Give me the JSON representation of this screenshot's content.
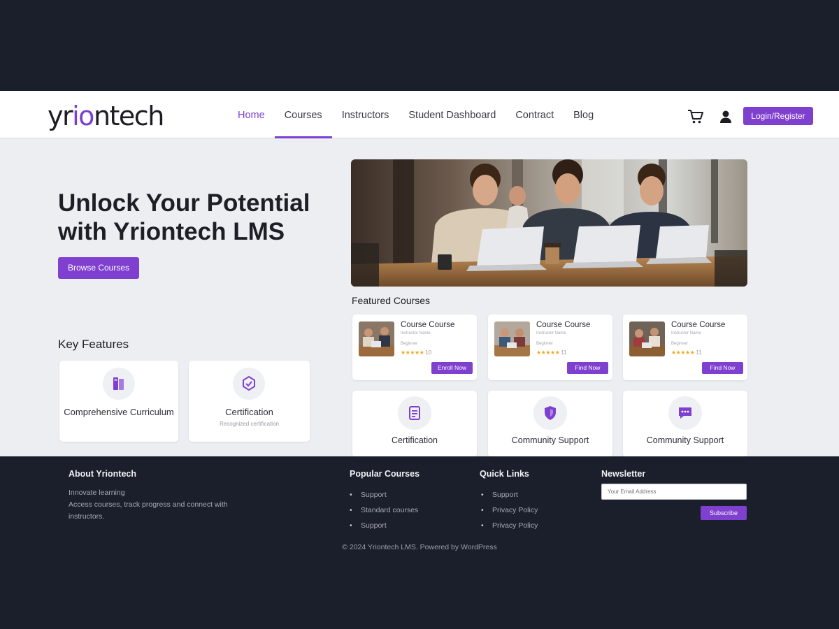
{
  "header": {
    "logo_text_start": "yr",
    "logo_text_dot": "io",
    "logo_text_end": "ntech",
    "nav": [
      {
        "label": "Home"
      },
      {
        "label": "Courses"
      },
      {
        "label": "Instructors"
      },
      {
        "label": "Student Dashboard"
      },
      {
        "label": "Contract"
      },
      {
        "label": "Blog"
      }
    ],
    "login_label": "Login/Register",
    "icons": [
      "cart-icon",
      "user-icon"
    ]
  },
  "hero": {
    "title": "Unlock Your Potential with Yriontech LMS",
    "button_label": "Browse Courses"
  },
  "key_features": {
    "title": "Key Features",
    "items": [
      {
        "label": "Comprehensive Curriculum",
        "icon": "book-icon"
      },
      {
        "label": "Certification",
        "sub": "Recognized certification",
        "icon": "certificate-icon"
      }
    ]
  },
  "featured_courses": {
    "title": "Featured Courses",
    "courses": [
      {
        "name": "Course Course",
        "meta": "Instructor Name",
        "meta2": "Beginner",
        "rating": "★★★★★",
        "rating_count": "10",
        "button": "Enroll Now"
      },
      {
        "name": "Course Course",
        "meta": "Instructor Name",
        "meta2": "Beginner",
        "rating": "★★★★★",
        "rating_count": "11",
        "button": "Find Now"
      },
      {
        "name": "Course Course",
        "meta": "Instructor Name",
        "meta2": "Beginner",
        "rating": "★★★★★",
        "rating_count": "11",
        "button": "Find Now"
      }
    ],
    "features": [
      {
        "label": "Certification",
        "icon": "document-icon"
      },
      {
        "label": "Community Support",
        "icon": "shield-icon"
      },
      {
        "label": "Community Support",
        "icon": "chat-icon"
      }
    ]
  },
  "footer": {
    "about": {
      "title": "About Yriontech",
      "line1": "Innovate learning",
      "line2": "Access courses, track progress and connect with",
      "line3": "instructors."
    },
    "popular": {
      "title": "Popular Courses",
      "items": [
        "Support",
        "Standard courses",
        "Support"
      ]
    },
    "quick": {
      "title": "Quick Links",
      "items": [
        "Support",
        "Privacy Policy",
        "Privacy Policy"
      ]
    },
    "newsletter": {
      "title": "Newsletter",
      "placeholder": "Your Email Address",
      "button": "Subscribe"
    },
    "copyright": "© 2024 Yriontech LMS. Powered by WordPress"
  },
  "colors": {
    "accent": "#7f3fcf",
    "dark_bg": "#1b1e2b",
    "page_bg": "#eceef2"
  }
}
